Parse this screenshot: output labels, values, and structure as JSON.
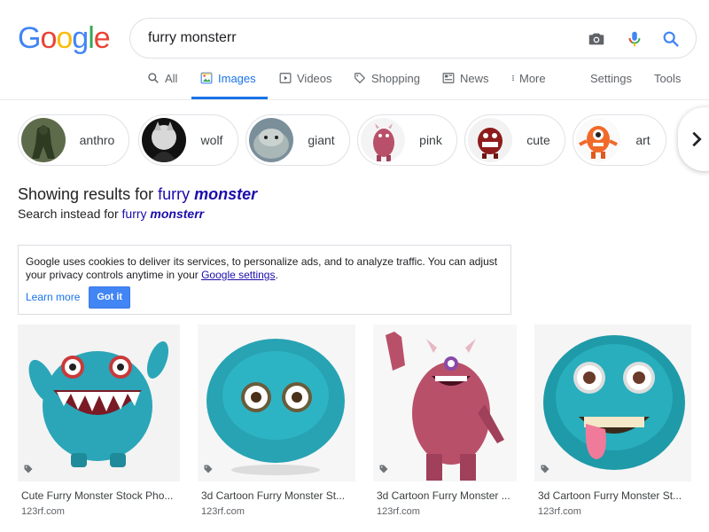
{
  "logo": {
    "letters": [
      "G",
      "o",
      "o",
      "g",
      "l",
      "e"
    ],
    "colors": [
      "#4285F4",
      "#EA4335",
      "#FBBC05",
      "#4285F4",
      "#34A853",
      "#EA4335"
    ]
  },
  "search": {
    "value": "furry monsterr",
    "icons": [
      "camera-icon",
      "microphone-icon",
      "search-icon"
    ]
  },
  "tabs": [
    {
      "label": "All",
      "icon": "search-icon"
    },
    {
      "label": "Images",
      "icon": "image-icon",
      "active": true
    },
    {
      "label": "Videos",
      "icon": "play-icon"
    },
    {
      "label": "Shopping",
      "icon": "tag-icon"
    },
    {
      "label": "News",
      "icon": "newspaper-icon"
    },
    {
      "label": "More",
      "icon": "dots-vertical-icon"
    },
    {
      "label": "Settings"
    },
    {
      "label": "Tools"
    }
  ],
  "chips": [
    {
      "label": "anthro"
    },
    {
      "label": "wolf"
    },
    {
      "label": "giant"
    },
    {
      "label": "pink"
    },
    {
      "label": "cute"
    },
    {
      "label": "art"
    }
  ],
  "correction": {
    "showing_prefix": "Showing results for",
    "corrected_plain": "furry",
    "corrected_bold": "monster",
    "instead_prefix": "Search instead for",
    "original_plain": "furry",
    "original_bold": "monsterr"
  },
  "cookie": {
    "text": "Google uses cookies to deliver its services, to personalize ads, and to analyze traffic. You can adjust your privacy controls anytime in your",
    "link": "Google settings",
    "period": ".",
    "learn_more": "Learn more",
    "got_it": "Got it"
  },
  "results": [
    {
      "title": "Cute Furry Monster Stock Pho...",
      "source": "123rf.com"
    },
    {
      "title": "3d Cartoon Furry Monster St...",
      "source": "123rf.com"
    },
    {
      "title": "3d Cartoon Furry Monster ...",
      "source": "123rf.com"
    },
    {
      "title": "3d Cartoon Furry Monster St...",
      "source": "123rf.com"
    }
  ],
  "colors": {
    "accent": "#1a73e8",
    "link": "#1a0dab",
    "teal_fur": "#2aa6b8",
    "pink_fur": "#b9506a"
  }
}
